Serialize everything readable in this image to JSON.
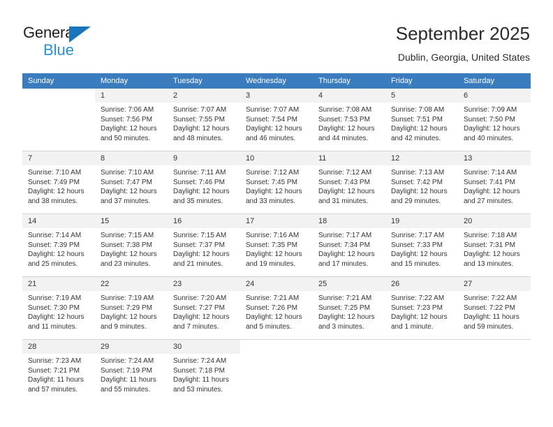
{
  "brand": {
    "name_dark": "General",
    "name_blue": "Blue",
    "accent_color": "#1b75bb",
    "accent_color_light": "#2b8fd4"
  },
  "header": {
    "title": "September 2025",
    "subtitle": "Dublin, Georgia, United States"
  },
  "theme": {
    "header_row_bg": "#3b7cbf",
    "daynum_bg": "#f2f2f2",
    "grid_line": "#d4d4d4",
    "text": "#333333"
  },
  "weekday_headers": [
    "Sunday",
    "Monday",
    "Tuesday",
    "Wednesday",
    "Thursday",
    "Friday",
    "Saturday"
  ],
  "weeks": [
    [
      {
        "day": "",
        "blank": true,
        "sunrise": "",
        "sunset": "",
        "daylight1": "",
        "daylight2": ""
      },
      {
        "day": "1",
        "sunrise": "Sunrise: 7:06 AM",
        "sunset": "Sunset: 7:56 PM",
        "daylight1": "Daylight: 12 hours",
        "daylight2": "and 50 minutes."
      },
      {
        "day": "2",
        "sunrise": "Sunrise: 7:07 AM",
        "sunset": "Sunset: 7:55 PM",
        "daylight1": "Daylight: 12 hours",
        "daylight2": "and 48 minutes."
      },
      {
        "day": "3",
        "sunrise": "Sunrise: 7:07 AM",
        "sunset": "Sunset: 7:54 PM",
        "daylight1": "Daylight: 12 hours",
        "daylight2": "and 46 minutes."
      },
      {
        "day": "4",
        "sunrise": "Sunrise: 7:08 AM",
        "sunset": "Sunset: 7:53 PM",
        "daylight1": "Daylight: 12 hours",
        "daylight2": "and 44 minutes."
      },
      {
        "day": "5",
        "sunrise": "Sunrise: 7:08 AM",
        "sunset": "Sunset: 7:51 PM",
        "daylight1": "Daylight: 12 hours",
        "daylight2": "and 42 minutes."
      },
      {
        "day": "6",
        "sunrise": "Sunrise: 7:09 AM",
        "sunset": "Sunset: 7:50 PM",
        "daylight1": "Daylight: 12 hours",
        "daylight2": "and 40 minutes."
      }
    ],
    [
      {
        "day": "7",
        "sunrise": "Sunrise: 7:10 AM",
        "sunset": "Sunset: 7:49 PM",
        "daylight1": "Daylight: 12 hours",
        "daylight2": "and 38 minutes."
      },
      {
        "day": "8",
        "sunrise": "Sunrise: 7:10 AM",
        "sunset": "Sunset: 7:47 PM",
        "daylight1": "Daylight: 12 hours",
        "daylight2": "and 37 minutes."
      },
      {
        "day": "9",
        "sunrise": "Sunrise: 7:11 AM",
        "sunset": "Sunset: 7:46 PM",
        "daylight1": "Daylight: 12 hours",
        "daylight2": "and 35 minutes."
      },
      {
        "day": "10",
        "sunrise": "Sunrise: 7:12 AM",
        "sunset": "Sunset: 7:45 PM",
        "daylight1": "Daylight: 12 hours",
        "daylight2": "and 33 minutes."
      },
      {
        "day": "11",
        "sunrise": "Sunrise: 7:12 AM",
        "sunset": "Sunset: 7:43 PM",
        "daylight1": "Daylight: 12 hours",
        "daylight2": "and 31 minutes."
      },
      {
        "day": "12",
        "sunrise": "Sunrise: 7:13 AM",
        "sunset": "Sunset: 7:42 PM",
        "daylight1": "Daylight: 12 hours",
        "daylight2": "and 29 minutes."
      },
      {
        "day": "13",
        "sunrise": "Sunrise: 7:14 AM",
        "sunset": "Sunset: 7:41 PM",
        "daylight1": "Daylight: 12 hours",
        "daylight2": "and 27 minutes."
      }
    ],
    [
      {
        "day": "14",
        "sunrise": "Sunrise: 7:14 AM",
        "sunset": "Sunset: 7:39 PM",
        "daylight1": "Daylight: 12 hours",
        "daylight2": "and 25 minutes."
      },
      {
        "day": "15",
        "sunrise": "Sunrise: 7:15 AM",
        "sunset": "Sunset: 7:38 PM",
        "daylight1": "Daylight: 12 hours",
        "daylight2": "and 23 minutes."
      },
      {
        "day": "16",
        "sunrise": "Sunrise: 7:15 AM",
        "sunset": "Sunset: 7:37 PM",
        "daylight1": "Daylight: 12 hours",
        "daylight2": "and 21 minutes."
      },
      {
        "day": "17",
        "sunrise": "Sunrise: 7:16 AM",
        "sunset": "Sunset: 7:35 PM",
        "daylight1": "Daylight: 12 hours",
        "daylight2": "and 19 minutes."
      },
      {
        "day": "18",
        "sunrise": "Sunrise: 7:17 AM",
        "sunset": "Sunset: 7:34 PM",
        "daylight1": "Daylight: 12 hours",
        "daylight2": "and 17 minutes."
      },
      {
        "day": "19",
        "sunrise": "Sunrise: 7:17 AM",
        "sunset": "Sunset: 7:33 PM",
        "daylight1": "Daylight: 12 hours",
        "daylight2": "and 15 minutes."
      },
      {
        "day": "20",
        "sunrise": "Sunrise: 7:18 AM",
        "sunset": "Sunset: 7:31 PM",
        "daylight1": "Daylight: 12 hours",
        "daylight2": "and 13 minutes."
      }
    ],
    [
      {
        "day": "21",
        "sunrise": "Sunrise: 7:19 AM",
        "sunset": "Sunset: 7:30 PM",
        "daylight1": "Daylight: 12 hours",
        "daylight2": "and 11 minutes."
      },
      {
        "day": "22",
        "sunrise": "Sunrise: 7:19 AM",
        "sunset": "Sunset: 7:29 PM",
        "daylight1": "Daylight: 12 hours",
        "daylight2": "and 9 minutes."
      },
      {
        "day": "23",
        "sunrise": "Sunrise: 7:20 AM",
        "sunset": "Sunset: 7:27 PM",
        "daylight1": "Daylight: 12 hours",
        "daylight2": "and 7 minutes."
      },
      {
        "day": "24",
        "sunrise": "Sunrise: 7:21 AM",
        "sunset": "Sunset: 7:26 PM",
        "daylight1": "Daylight: 12 hours",
        "daylight2": "and 5 minutes."
      },
      {
        "day": "25",
        "sunrise": "Sunrise: 7:21 AM",
        "sunset": "Sunset: 7:25 PM",
        "daylight1": "Daylight: 12 hours",
        "daylight2": "and 3 minutes."
      },
      {
        "day": "26",
        "sunrise": "Sunrise: 7:22 AM",
        "sunset": "Sunset: 7:23 PM",
        "daylight1": "Daylight: 12 hours",
        "daylight2": "and 1 minute."
      },
      {
        "day": "27",
        "sunrise": "Sunrise: 7:22 AM",
        "sunset": "Sunset: 7:22 PM",
        "daylight1": "Daylight: 11 hours",
        "daylight2": "and 59 minutes."
      }
    ],
    [
      {
        "day": "28",
        "sunrise": "Sunrise: 7:23 AM",
        "sunset": "Sunset: 7:21 PM",
        "daylight1": "Daylight: 11 hours",
        "daylight2": "and 57 minutes."
      },
      {
        "day": "29",
        "sunrise": "Sunrise: 7:24 AM",
        "sunset": "Sunset: 7:19 PM",
        "daylight1": "Daylight: 11 hours",
        "daylight2": "and 55 minutes."
      },
      {
        "day": "30",
        "sunrise": "Sunrise: 7:24 AM",
        "sunset": "Sunset: 7:18 PM",
        "daylight1": "Daylight: 11 hours",
        "daylight2": "and 53 minutes."
      },
      {
        "day": "",
        "blank": true,
        "sunrise": "",
        "sunset": "",
        "daylight1": "",
        "daylight2": ""
      },
      {
        "day": "",
        "blank": true,
        "sunrise": "",
        "sunset": "",
        "daylight1": "",
        "daylight2": ""
      },
      {
        "day": "",
        "blank": true,
        "sunrise": "",
        "sunset": "",
        "daylight1": "",
        "daylight2": ""
      },
      {
        "day": "",
        "blank": true,
        "sunrise": "",
        "sunset": "",
        "daylight1": "",
        "daylight2": ""
      }
    ]
  ]
}
